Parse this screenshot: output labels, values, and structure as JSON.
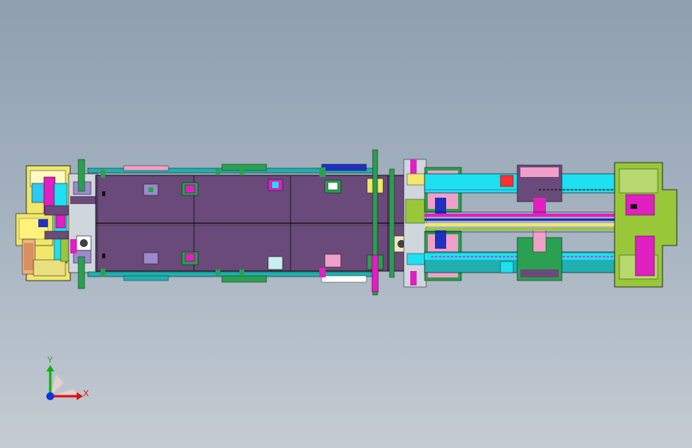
{
  "triad": {
    "x_label": "X",
    "y_label": "Y",
    "x_color": "#e01010",
    "y_color": "#10b010",
    "z_color": "#1030e0"
  },
  "palette": {
    "frame": "#6a4a7a",
    "frame_dark": "#4f3560",
    "cyan": "#1ee0f0",
    "teal": "#20b0b0",
    "yellow": "#f0e86a",
    "lime": "#98c83a",
    "magenta": "#e020c0",
    "pink": "#f0a0c8",
    "orange": "#f0a020",
    "green": "#2aa050",
    "blue": "#2030c0",
    "white": "#ffffff",
    "outline": "#101010"
  }
}
